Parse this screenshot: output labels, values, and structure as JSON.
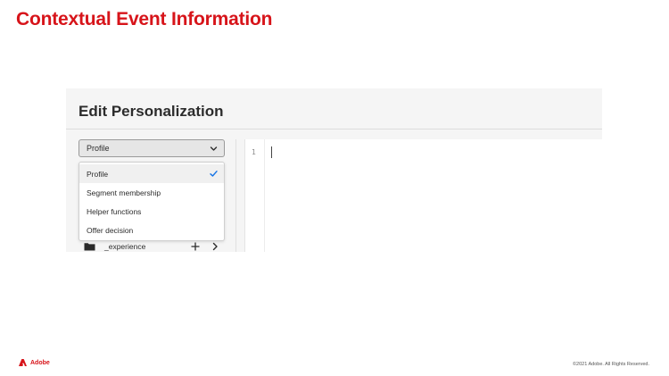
{
  "slide": {
    "title": "Contextual Event Information"
  },
  "dialog": {
    "title": "Edit Personalization",
    "picker": {
      "selected": "Profile",
      "icon": "chevron-down-icon"
    },
    "menu": {
      "items": [
        {
          "label": "Profile",
          "selected": true
        },
        {
          "label": "Segment membership",
          "selected": false
        },
        {
          "label": "Helper functions",
          "selected": false
        },
        {
          "label": "Offer decision",
          "selected": false
        }
      ],
      "check_icon": "checkmark-icon"
    },
    "tree": {
      "item_label": "_experience",
      "folder_icon": "folder-icon",
      "add_icon": "plus-icon",
      "expand_icon": "chevron-right-icon"
    },
    "editor": {
      "line_number": "1"
    }
  },
  "footer": {
    "brand": "Adobe",
    "copyright": "©2021 Adobe. All Rights Reserved."
  },
  "colors": {
    "brand_red": "#d7141a",
    "check_blue": "#1473e6",
    "panel_bg": "#f5f5f5"
  }
}
